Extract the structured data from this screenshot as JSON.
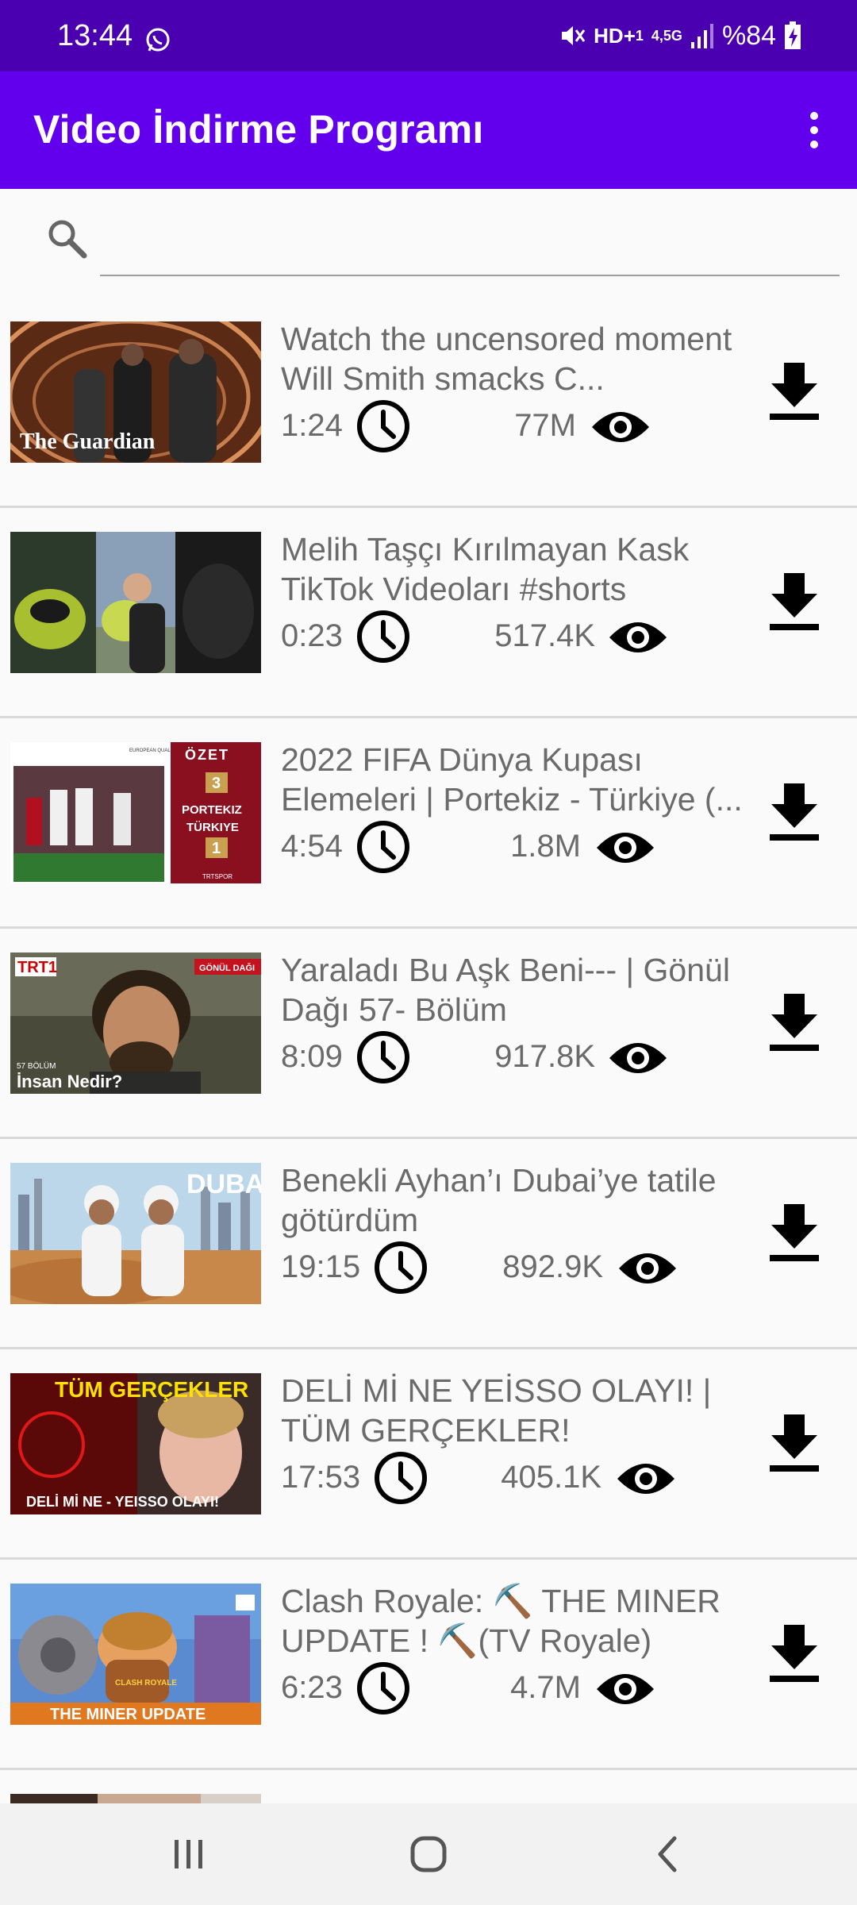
{
  "status_bar": {
    "time": "13:44",
    "network": "HD+",
    "network_sub": "1",
    "lte": "4,5G",
    "battery": "%84"
  },
  "app_bar": {
    "title": "Video İndirme Programı",
    "menu_icon": "more-vert-icon"
  },
  "search": {
    "value": "",
    "placeholder": "",
    "icon": "search-icon"
  },
  "videos": [
    {
      "title": "Watch the uncensored moment Will Smith smacks C...",
      "duration": "1:24",
      "views": "77M",
      "thumb_caption": "The Guardian"
    },
    {
      "title": "Melih Taşçı Kırılmayan Kask TikTok Videoları #shorts",
      "duration": "0:23",
      "views": "517.4K",
      "thumb_caption": ""
    },
    {
      "title": "2022 FIFA Dünya Kupası Elemeleri | Portekiz - Türkiye (...",
      "duration": "4:54",
      "views": "1.8M",
      "thumb_caption": "ÖZET"
    },
    {
      "title": "Yaraladı Bu Aşk Beni--- | Gönül Dağı 57- Bölüm",
      "duration": "8:09",
      "views": "917.8K",
      "thumb_caption": "İnsan Nedir?"
    },
    {
      "title": "Benekli Ayhan’ı Dubai’ye tatile götürdüm",
      "duration": "19:15",
      "views": "892.9K",
      "thumb_caption": "DUBAI"
    },
    {
      "title": "DELİ Mİ NE YEİSSO OLAYI! | TÜM GERÇEKLER!",
      "duration": "17:53",
      "views": "405.1K",
      "thumb_caption": "TÜM GERÇEKLER"
    },
    {
      "title": "Clash Royale: ⛏️ THE MINER UPDATE ! ⛏️(TV Royale)",
      "duration": "6:23",
      "views": "4.7M",
      "thumb_caption": "THE MINER UPDATE"
    }
  ],
  "thumb_extra": {
    "fifa_team1": "PORTEKIZ",
    "fifa_team2": "TÜRKIYE",
    "fifa_score1": "3",
    "fifa_score2": "1",
    "trt_logo": "TRT1",
    "gonul_tag": "GÖNÜL DAĞI",
    "gonul_ep": "57 BÖLÜM",
    "deli_caption": "DELİ Mİ NE - YEISSO OLAYI!",
    "fifa_badge": "EUROPEAN QUALIFIERS",
    "fifa_channel": "TRTSPOR",
    "clash_logo": "CLASH ROYALE"
  },
  "icons": {
    "clock": "clock-icon",
    "views": "eye-icon",
    "download": "download-icon"
  },
  "nav_bar": {
    "recents": "recents-icon",
    "home": "home-icon",
    "back": "back-icon"
  },
  "colors": {
    "status_bar": "#4a00b0",
    "app_bar": "#6200ee",
    "text_secondary": "#6b6b6b"
  }
}
